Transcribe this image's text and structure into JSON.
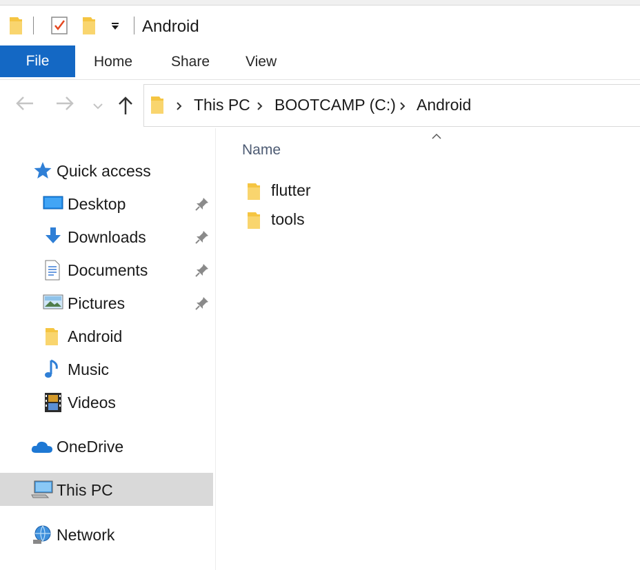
{
  "window": {
    "title": "Android",
    "quick_access_toolbar": [
      "folder-icon",
      "properties-check-icon",
      "new-folder-icon",
      "customize-dropdown-icon"
    ]
  },
  "ribbon": {
    "tabs": [
      {
        "label": "File",
        "active": true
      },
      {
        "label": "Home"
      },
      {
        "label": "Share"
      },
      {
        "label": "View"
      }
    ]
  },
  "navigation": {
    "buttons": [
      "back-arrow-icon",
      "forward-arrow-icon",
      "recent-locations-icon",
      "up-arrow-icon"
    ],
    "breadcrumb": [
      "This PC",
      "BOOTCAMP (C:)",
      "Android"
    ]
  },
  "sidebar": {
    "quick_access": {
      "label": "Quick access",
      "icon": "star-icon"
    },
    "items": [
      {
        "label": "Desktop",
        "icon": "desktop-icon",
        "pinned": true
      },
      {
        "label": "Downloads",
        "icon": "downloads-icon",
        "pinned": true
      },
      {
        "label": "Documents",
        "icon": "documents-icon",
        "pinned": true
      },
      {
        "label": "Pictures",
        "icon": "pictures-icon",
        "pinned": true
      },
      {
        "label": "Android",
        "icon": "folder-icon",
        "pinned": false
      },
      {
        "label": "Music",
        "icon": "music-icon",
        "pinned": false
      },
      {
        "label": "Videos",
        "icon": "videos-icon",
        "pinned": false
      }
    ],
    "onedrive": {
      "label": "OneDrive",
      "icon": "cloud-icon"
    },
    "this_pc": {
      "label": "This PC",
      "icon": "computer-icon",
      "selected": true
    },
    "network": {
      "label": "Network",
      "icon": "network-icon"
    }
  },
  "content": {
    "columns": [
      "Name"
    ],
    "sort_indicator": "ascending",
    "files": [
      {
        "name": "flutter",
        "type": "folder"
      },
      {
        "name": "tools",
        "type": "folder"
      }
    ]
  },
  "colors": {
    "accent": "#1468c4",
    "folder": "#f5c542",
    "selected_bg": "#d9d9d9",
    "column_header": "#4d5b73"
  }
}
